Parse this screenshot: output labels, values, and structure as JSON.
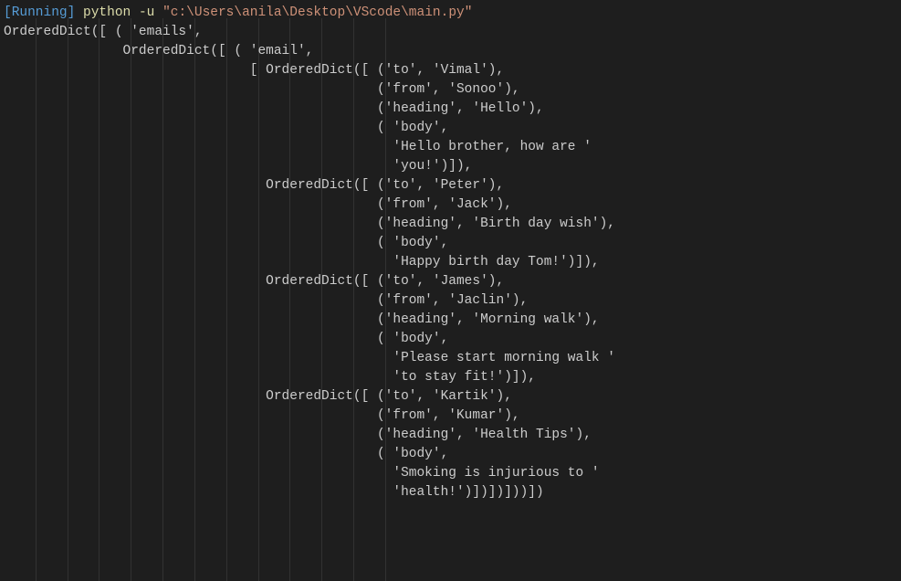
{
  "terminal": {
    "status_label": "[Running]",
    "command_interpreter": "python -u",
    "command_path": "\"c:\\Users\\anila\\Desktop\\VScode\\main.py\"",
    "output_lines": [
      "OrderedDict([ ( 'emails',",
      "               OrderedDict([ ( 'email',",
      "                               [ OrderedDict([ ('to', 'Vimal'),",
      "                                               ('from', 'Sonoo'),",
      "                                               ('heading', 'Hello'),",
      "                                               ( 'body',",
      "                                                 'Hello brother, how are '",
      "                                                 'you!')]),",
      "                                 OrderedDict([ ('to', 'Peter'),",
      "                                               ('from', 'Jack'),",
      "                                               ('heading', 'Birth day wish'),",
      "                                               ( 'body',",
      "                                                 'Happy birth day Tom!')]),",
      "                                 OrderedDict([ ('to', 'James'),",
      "                                               ('from', 'Jaclin'),",
      "                                               ('heading', 'Morning walk'),",
      "                                               ( 'body',",
      "                                                 'Please start morning walk '",
      "                                                 'to stay fit!')]),",
      "                                 OrderedDict([ ('to', 'Kartik'),",
      "                                               ('from', 'Kumar'),",
      "                                               ('heading', 'Health Tips'),",
      "                                               ( 'body',",
      "                                                 'Smoking is injurious to '",
      "                                                 'health!')])])]))])"
    ]
  },
  "indent_guides": {
    "positions_ch": [
      4,
      8,
      12,
      16,
      20,
      24,
      28,
      32,
      36,
      40,
      44,
      48
    ]
  }
}
